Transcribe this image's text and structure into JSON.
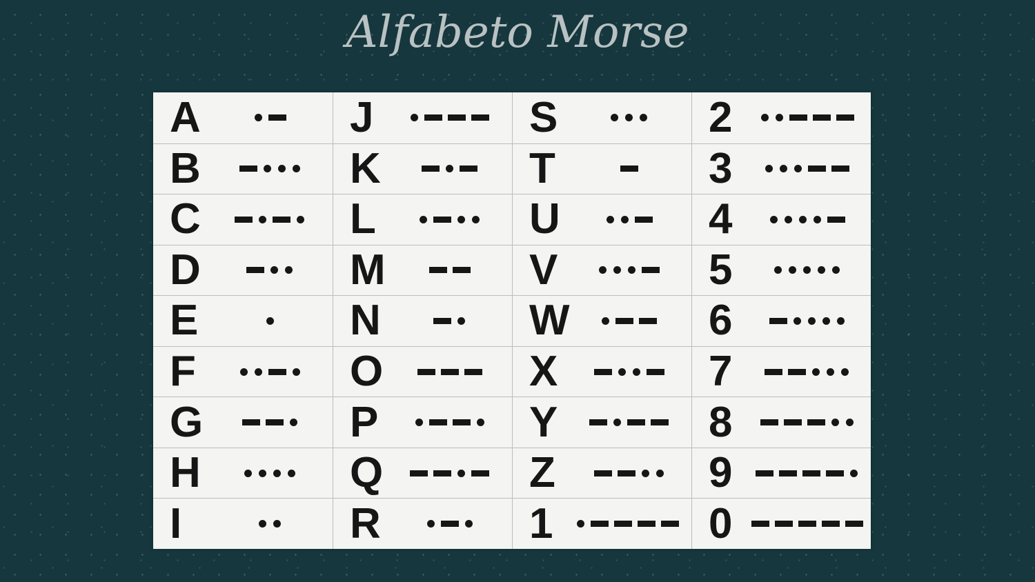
{
  "title": "Alfabeto Morse",
  "colors": {
    "background": "#15373d",
    "card": "#f4f4f3",
    "title": "#b9c1c2",
    "ink": "#161616"
  },
  "columns": [
    {
      "rows": [
        {
          "char": "A",
          "code": ".-"
        },
        {
          "char": "B",
          "code": "-..."
        },
        {
          "char": "C",
          "code": "-.-."
        },
        {
          "char": "D",
          "code": "-.."
        },
        {
          "char": "E",
          "code": "."
        },
        {
          "char": "F",
          "code": "..-."
        },
        {
          "char": "G",
          "code": "--."
        },
        {
          "char": "H",
          "code": "...."
        },
        {
          "char": "I",
          "code": ".."
        }
      ]
    },
    {
      "rows": [
        {
          "char": "J",
          "code": ".---"
        },
        {
          "char": "K",
          "code": "-.-"
        },
        {
          "char": "L",
          "code": ".-.."
        },
        {
          "char": "M",
          "code": "--"
        },
        {
          "char": "N",
          "code": "-."
        },
        {
          "char": "O",
          "code": "---"
        },
        {
          "char": "P",
          "code": ".--."
        },
        {
          "char": "Q",
          "code": "--.-"
        },
        {
          "char": "R",
          "code": ".-."
        }
      ]
    },
    {
      "rows": [
        {
          "char": "S",
          "code": "..."
        },
        {
          "char": "T",
          "code": "-"
        },
        {
          "char": "U",
          "code": "..-"
        },
        {
          "char": "V",
          "code": "...-"
        },
        {
          "char": "W",
          "code": ".--"
        },
        {
          "char": "X",
          "code": "-..-"
        },
        {
          "char": "Y",
          "code": "-.--"
        },
        {
          "char": "Z",
          "code": "--.."
        },
        {
          "char": "1",
          "code": ".----"
        }
      ]
    },
    {
      "rows": [
        {
          "char": "2",
          "code": "..---"
        },
        {
          "char": "3",
          "code": "...--"
        },
        {
          "char": "4",
          "code": "....-"
        },
        {
          "char": "5",
          "code": "....."
        },
        {
          "char": "6",
          "code": "-...."
        },
        {
          "char": "7",
          "code": "--..."
        },
        {
          "char": "8",
          "code": "---.."
        },
        {
          "char": "9",
          "code": "----."
        },
        {
          "char": "0",
          "code": "-----"
        }
      ]
    }
  ]
}
